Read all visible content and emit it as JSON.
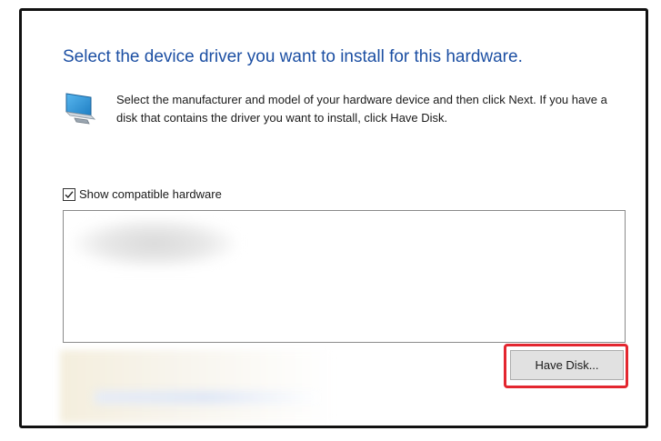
{
  "dialog": {
    "heading": "Select the device driver you want to install for this hardware.",
    "instructions": "Select the manufacturer and model of your hardware device and then click Next. If you have a disk that contains the driver you want to install, click Have Disk.",
    "show_compatible": {
      "label": "Show compatible hardware",
      "checked": true
    },
    "have_disk_label": "Have Disk...",
    "icon": "monitor-icon",
    "highlight_color": "#e3262f",
    "heading_color": "#1c4fa3"
  }
}
